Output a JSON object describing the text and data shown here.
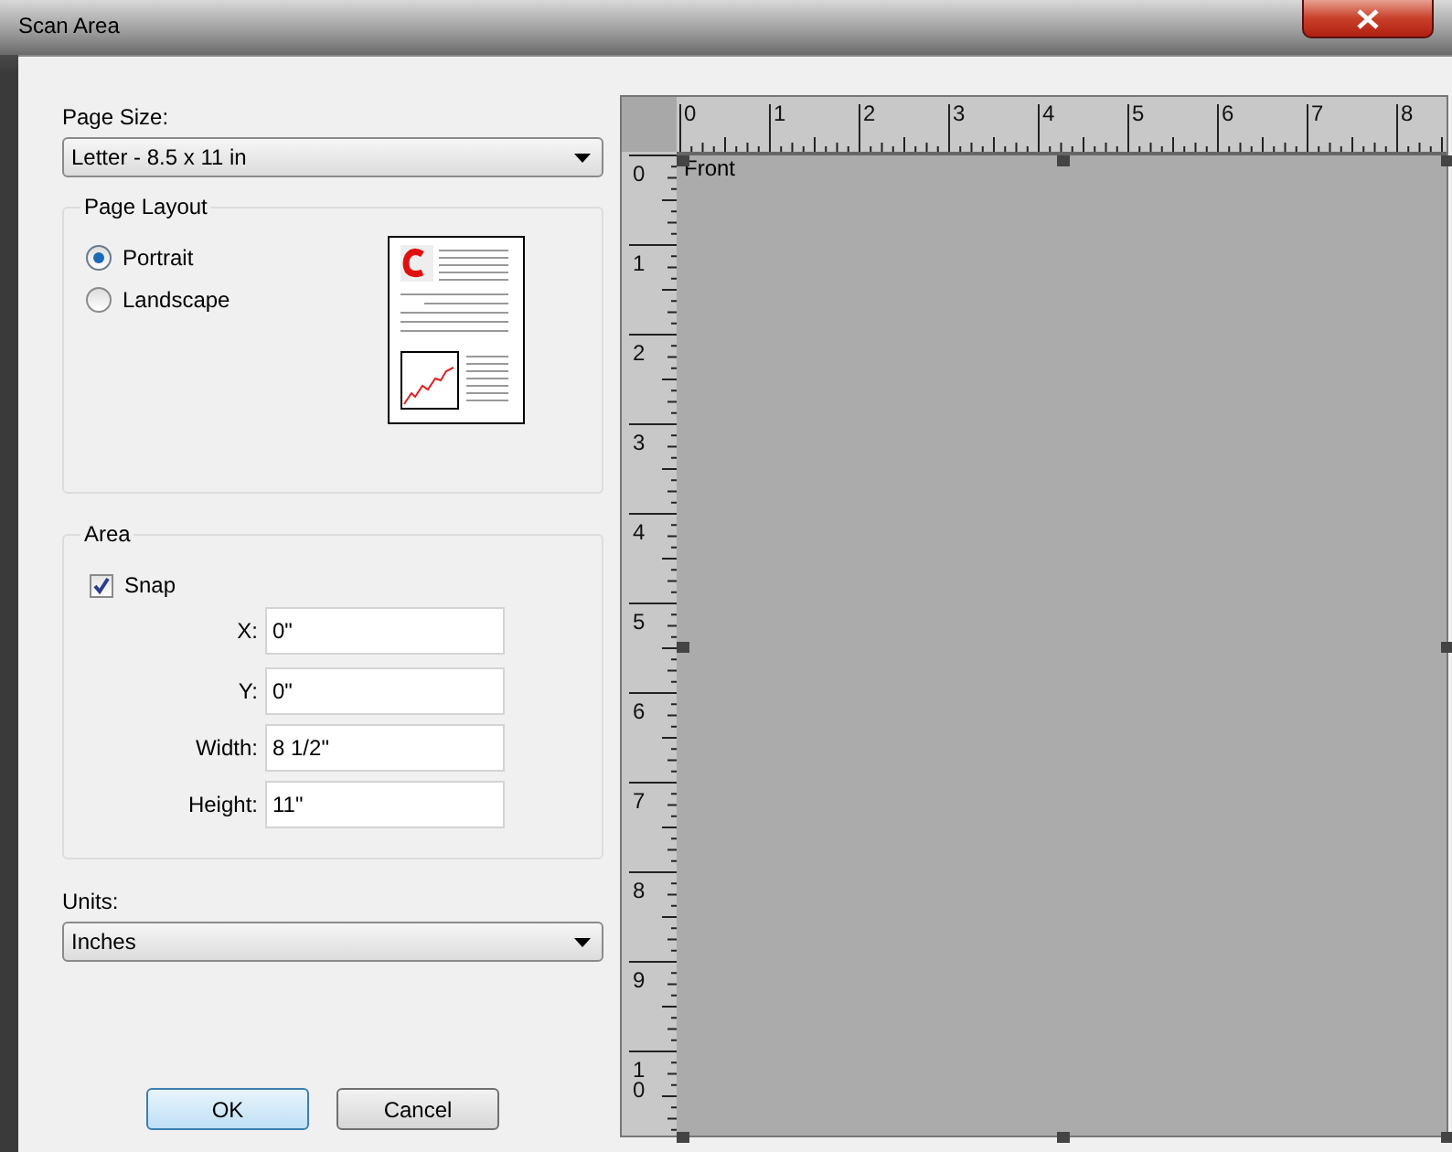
{
  "window": {
    "title": "Scan Area"
  },
  "page_size": {
    "label": "Page Size:",
    "value": "Letter - 8.5 x 11 in"
  },
  "page_layout": {
    "title": "Page Layout",
    "options": [
      {
        "label": "Portrait",
        "selected": true
      },
      {
        "label": "Landscape",
        "selected": false
      }
    ]
  },
  "area": {
    "title": "Area",
    "snap": {
      "label": "Snap",
      "checked": true
    },
    "fields": [
      {
        "label": "X:",
        "value": "0\""
      },
      {
        "label": "Y:",
        "value": "0\""
      },
      {
        "label": "Width:",
        "value": "8 1/2\""
      },
      {
        "label": "Height:",
        "value": "11\""
      }
    ]
  },
  "units": {
    "label": "Units:",
    "value": "Inches"
  },
  "buttons": [
    {
      "label": "OK",
      "kind": "default"
    },
    {
      "label": "Cancel",
      "kind": "normal"
    }
  ],
  "preview": {
    "horizontal_ruler": [
      "0",
      "1",
      "2",
      "3",
      "4",
      "5",
      "6",
      "7",
      "8"
    ],
    "vertical_ruler": [
      "0",
      "1",
      "2",
      "3",
      "4",
      "5",
      "6",
      "7",
      "8",
      "9",
      "10"
    ],
    "side": "Front"
  }
}
